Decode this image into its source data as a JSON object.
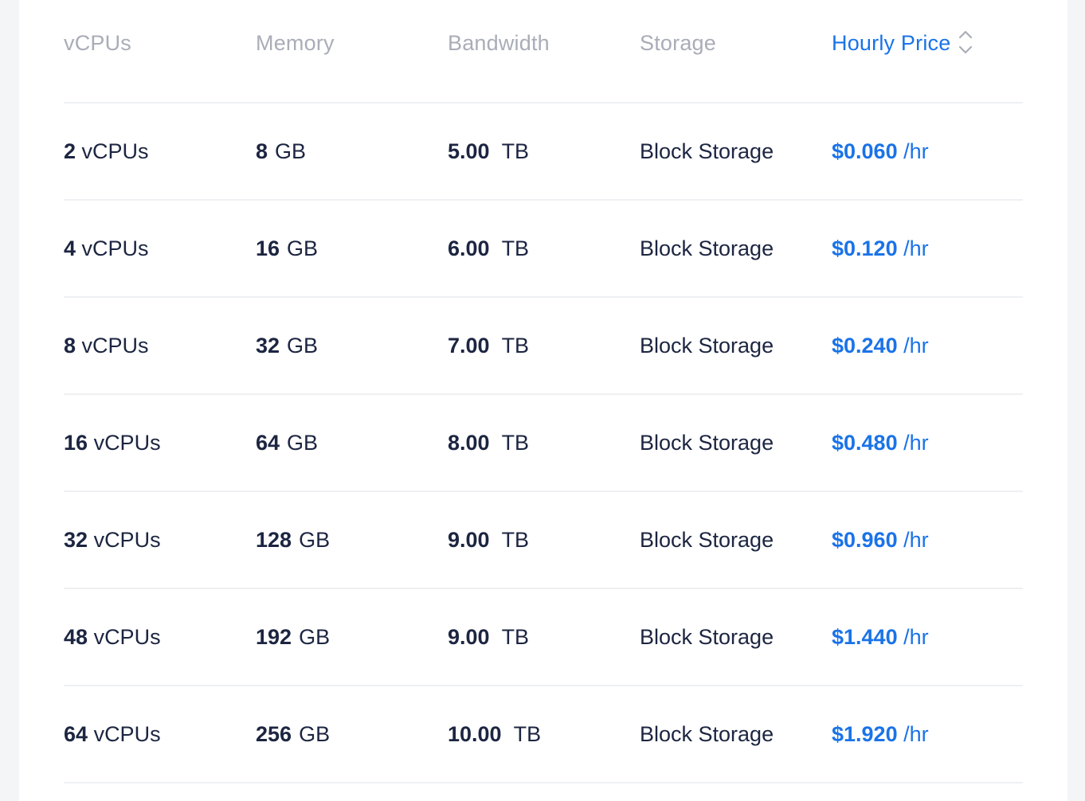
{
  "colors": {
    "accent": "#1a73e8",
    "header_text": "#a9adb7",
    "body_text": "#1c2541",
    "divider": "#eef0f3"
  },
  "header": {
    "vcpus": "vCPUs",
    "memory": "Memory",
    "bandwidth": "Bandwidth",
    "storage": "Storage",
    "hourly_price": "Hourly Price",
    "sort_icon": "sort-updown-icon"
  },
  "rows": [
    {
      "vcpu_num": "2",
      "vcpu_unit": "vCPUs",
      "mem_num": "8",
      "mem_unit": "GB",
      "bw_num": "5.00",
      "bw_unit": "TB",
      "storage": "Block Storage",
      "price": "$0.060",
      "price_unit": "/hr"
    },
    {
      "vcpu_num": "4",
      "vcpu_unit": "vCPUs",
      "mem_num": "16",
      "mem_unit": "GB",
      "bw_num": "6.00",
      "bw_unit": "TB",
      "storage": "Block Storage",
      "price": "$0.120",
      "price_unit": "/hr"
    },
    {
      "vcpu_num": "8",
      "vcpu_unit": "vCPUs",
      "mem_num": "32",
      "mem_unit": "GB",
      "bw_num": "7.00",
      "bw_unit": "TB",
      "storage": "Block Storage",
      "price": "$0.240",
      "price_unit": "/hr"
    },
    {
      "vcpu_num": "16",
      "vcpu_unit": "vCPUs",
      "mem_num": "64",
      "mem_unit": "GB",
      "bw_num": "8.00",
      "bw_unit": "TB",
      "storage": "Block Storage",
      "price": "$0.480",
      "price_unit": "/hr"
    },
    {
      "vcpu_num": "32",
      "vcpu_unit": "vCPUs",
      "mem_num": "128",
      "mem_unit": "GB",
      "bw_num": "9.00",
      "bw_unit": "TB",
      "storage": "Block Storage",
      "price": "$0.960",
      "price_unit": "/hr"
    },
    {
      "vcpu_num": "48",
      "vcpu_unit": "vCPUs",
      "mem_num": "192",
      "mem_unit": "GB",
      "bw_num": "9.00",
      "bw_unit": "TB",
      "storage": "Block Storage",
      "price": "$1.440",
      "price_unit": "/hr"
    },
    {
      "vcpu_num": "64",
      "vcpu_unit": "vCPUs",
      "mem_num": "256",
      "mem_unit": "GB",
      "bw_num": "10.00",
      "bw_unit": "TB",
      "storage": "Block Storage",
      "price": "$1.920",
      "price_unit": "/hr"
    }
  ]
}
